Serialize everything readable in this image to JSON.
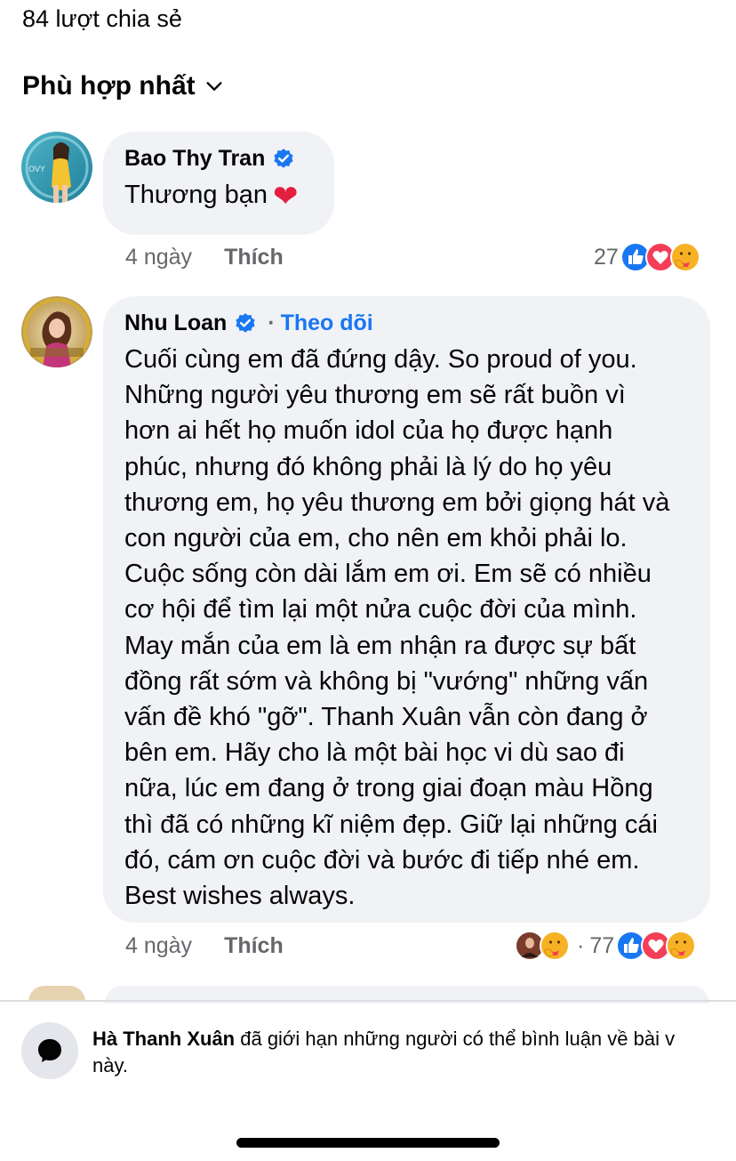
{
  "header": {
    "share_count": "84 lượt chia sẻ",
    "sort_label": "Phù hợp nhất"
  },
  "comments": [
    {
      "author": "Bao Thy Tran",
      "verified": true,
      "text": "Thương bạn",
      "emoji": "heart",
      "time": "4 ngày",
      "like_label": "Thích",
      "reaction_count": "27",
      "reactions": [
        "like-icon",
        "love-icon",
        "care-icon"
      ]
    },
    {
      "author": "Nhu Loan",
      "verified": true,
      "follow_label": "Theo dõi",
      "text_lines": [
        "Cuối cùng em đã đứng dậy. So proud of you.",
        "Những người yêu thương em sẽ rất buồn vì",
        "hơn ai hết họ muốn idol của họ được hạnh",
        "phúc, nhưng đó không phải là lý do họ yêu",
        "thương em, họ yêu thương em bởi giọng hát và",
        "con người của em, cho nên em khỏi phải lo.",
        "Cuộc sống còn dài lắm em ơi. Em sẽ có nhiều",
        "cơ hội để tìm lại một nửa cuộc đời của mình.",
        "May mắn của em là em nhận ra được sự bất",
        "đồng rất sớm và không bị \"vướng\" những vấn",
        "vấn đề khó \"gỡ\". Thanh Xuân vẫn còn đang ở",
        "bên em. Hãy cho là một bài học vi dù sao đi",
        "nữa, lúc em đang ở trong giai đoạn màu Hồng",
        "thì đã có những kĩ niệm đẹp. Giữ lại những cái",
        "đó, cám ơn cuộc đời và bước đi tiếp nhé em.",
        "Best wishes always."
      ],
      "time": "4 ngày",
      "like_label": "Thích",
      "reaction_count": "77",
      "reactions": [
        "like-icon",
        "love-icon",
        "care-icon"
      ]
    }
  ],
  "restriction": {
    "name": "Hà Thanh Xuân",
    "message": " đã giới hạn những người có thể bình luận về bài v",
    "message_line2": "này."
  },
  "colors": {
    "accent": "#1877f2",
    "bubble": "#f0f2f5",
    "secondary_text": "#65676b",
    "love": "#f33e58"
  }
}
